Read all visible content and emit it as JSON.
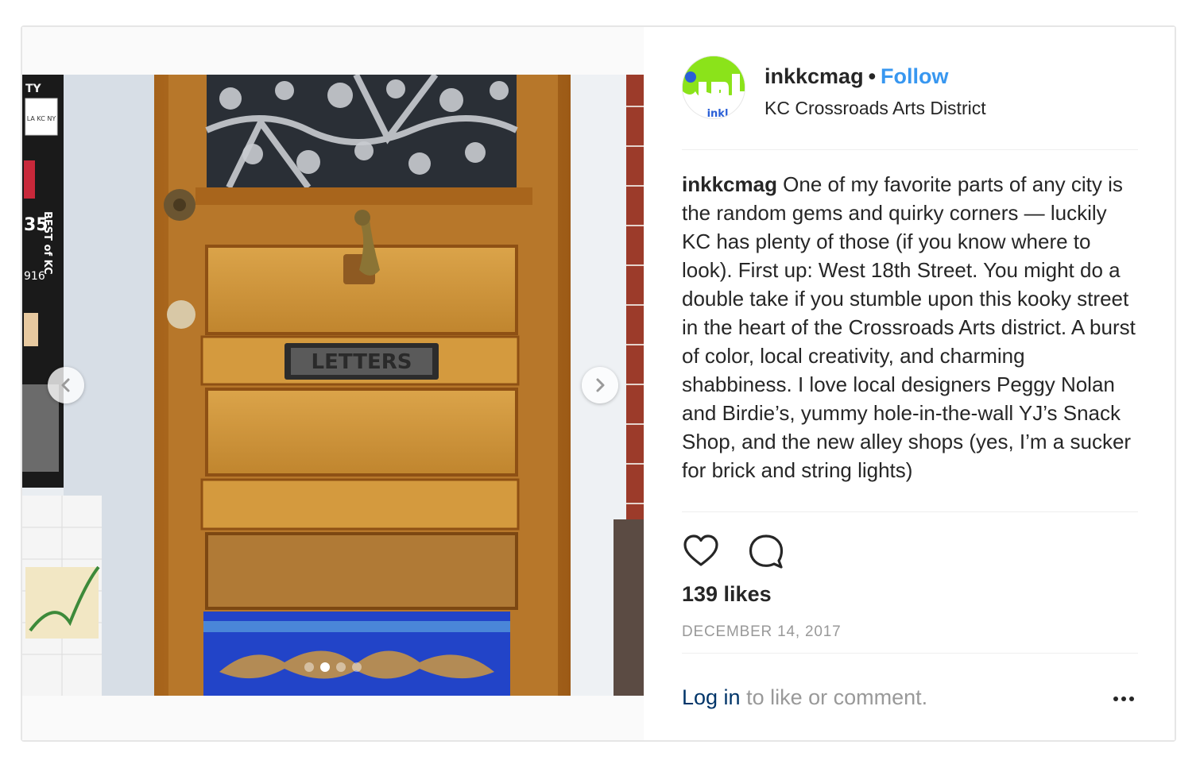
{
  "post": {
    "username": "inkkcmag",
    "bullet": "•",
    "follow_label": "Follow",
    "location": "KC Crossroads Arts District",
    "avatar_text": "inkl",
    "photo": {
      "door_plate_text": "LETTERS",
      "sticker_top": "TY",
      "sticker_heart": "LA KC NY",
      "sticker_best": "BEST of KC",
      "sticker_num": "35",
      "sticker_year": "916"
    },
    "carousel": {
      "total": 4,
      "active_index": 1
    },
    "caption_user": "inkkcmag",
    "caption_text": " One of my favorite parts of any city is the random gems and quirky corners — luckily KC has plenty of those (if you know where to look). First up: West 18th Street. You might do a double take if you stumble upon this kooky street in the heart of the Crossroads Arts district. A burst of color, local creativity, and charming shabbiness. I love local designers Peggy Nolan and Birdie’s, yummy hole-in-the-wall YJ’s Snack Shop, and the new alley shops (yes, I’m a sucker for brick and string lights)",
    "likes": "139 likes",
    "date": "DECEMBER 14, 2017",
    "login_link": "Log in",
    "login_rest": " to like or comment."
  },
  "icons": {
    "like": "heart-icon",
    "comment": "comment-bubble-icon",
    "prev": "chevron-left-icon",
    "next": "chevron-right-icon",
    "more": "more-options-icon"
  },
  "colors": {
    "follow": "#3897f0",
    "login_link": "#003569",
    "muted": "#999999",
    "text": "#262626",
    "avatar_green": "#8be31a"
  }
}
